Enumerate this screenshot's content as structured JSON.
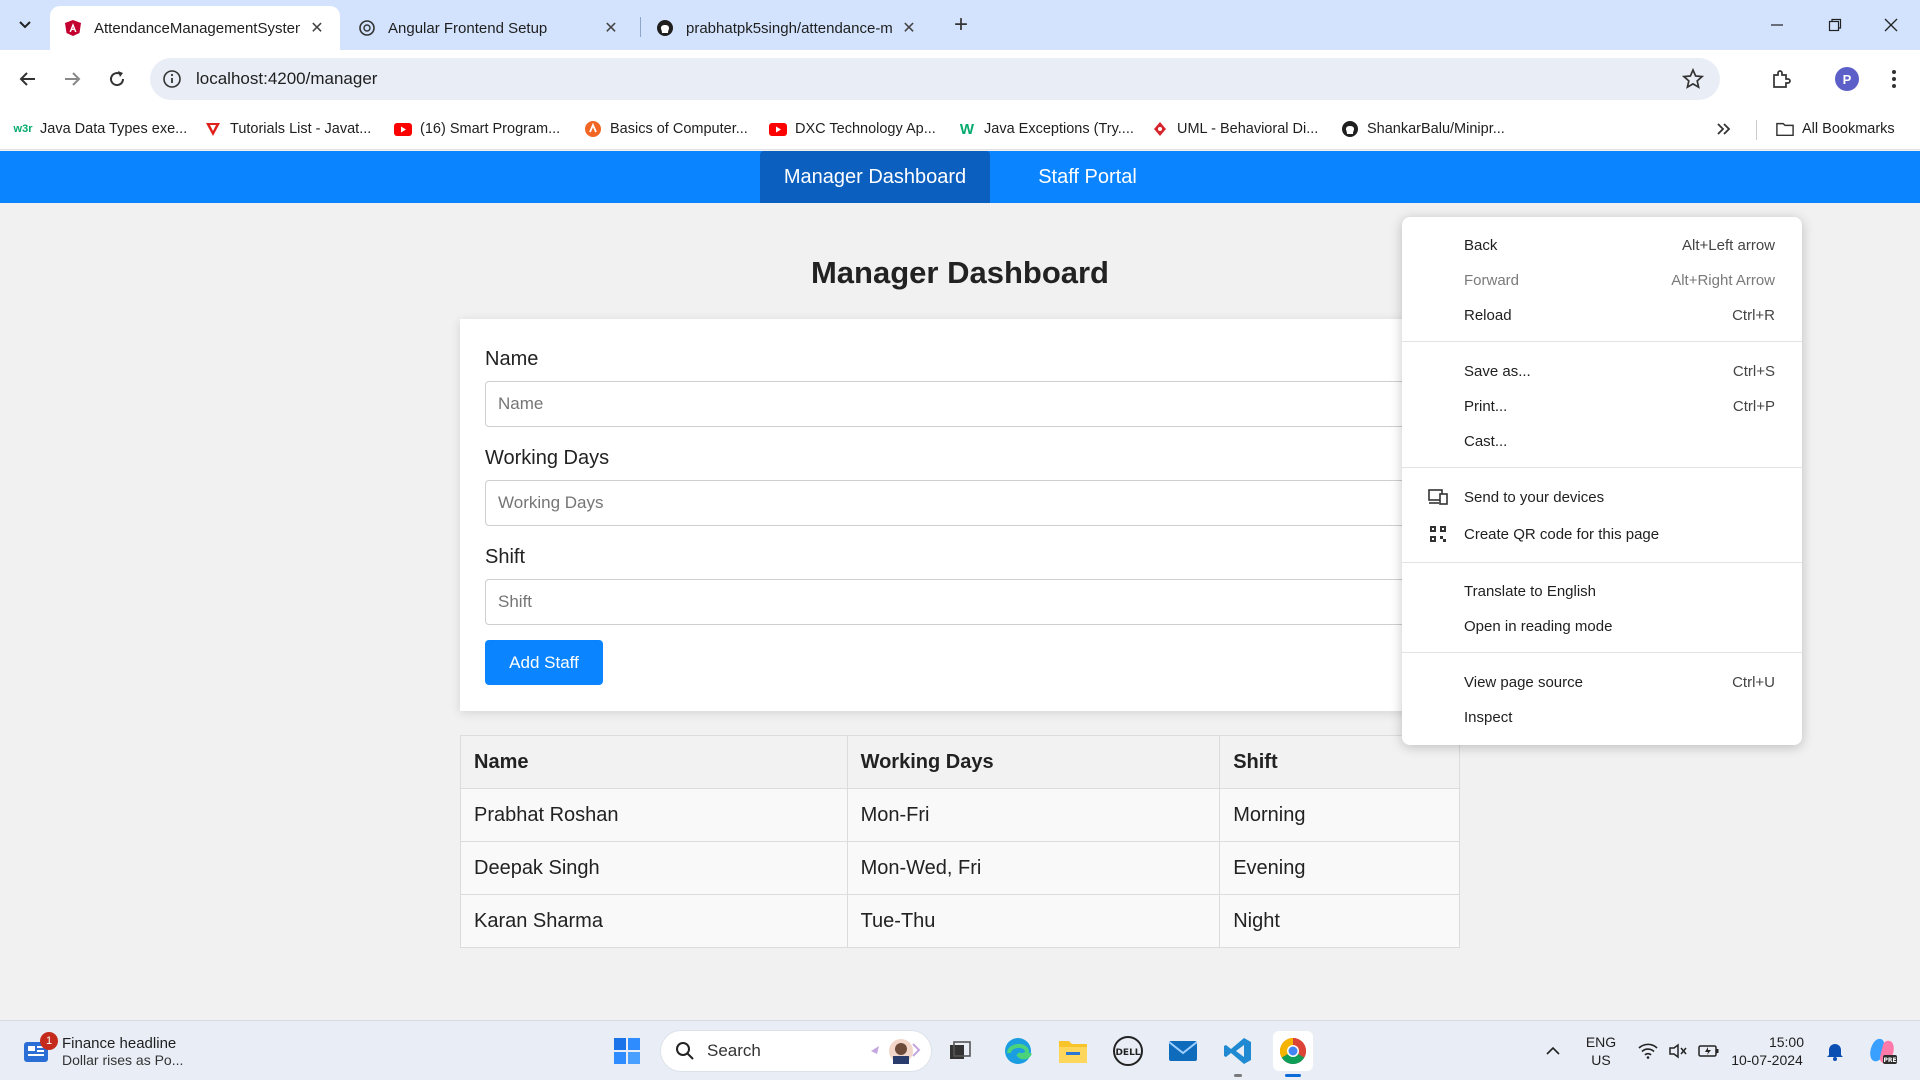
{
  "browser": {
    "tabs": [
      {
        "title": "AttendanceManagementSystem",
        "favicon": "angular-icon",
        "active": true
      },
      {
        "title": "Angular Frontend Setup",
        "favicon": "openai-icon",
        "active": false
      },
      {
        "title": "prabhatpk5singh/attendance-m",
        "favicon": "github-icon",
        "active": false
      }
    ],
    "url": "localhost:4200/manager",
    "profile_initial": "P",
    "bookmarks": [
      {
        "label": "Java Data Types exe...",
        "icon": "w3schools-icon"
      },
      {
        "label": "Tutorials List - Javat...",
        "icon": "javatpoint-icon"
      },
      {
        "label": "(16) Smart Program...",
        "icon": "youtube-icon"
      },
      {
        "label": "Basics of Computer...",
        "icon": "orange-logo-icon"
      },
      {
        "label": "DXC Technology Ap...",
        "icon": "youtube-icon"
      },
      {
        "label": "Java Exceptions (Try....",
        "icon": "w3schools-icon"
      },
      {
        "label": "UML - Behavioral Di...",
        "icon": "diamond-icon"
      },
      {
        "label": "ShankarBalu/Minipr...",
        "icon": "github-icon"
      }
    ],
    "all_bookmarks_label": "All Bookmarks"
  },
  "app": {
    "nav": [
      {
        "label": "Manager Dashboard",
        "active": true
      },
      {
        "label": "Staff Portal",
        "active": false
      }
    ],
    "heading": "Manager Dashboard",
    "form": {
      "name_label": "Name",
      "name_placeholder": "Name",
      "days_label": "Working Days",
      "days_placeholder": "Working Days",
      "shift_label": "Shift",
      "shift_placeholder": "Shift",
      "submit_label": "Add Staff"
    },
    "table": {
      "headers": [
        "Name",
        "Working Days",
        "Shift"
      ],
      "rows": [
        [
          "Prabhat Roshan",
          "Mon-Fri",
          "Morning"
        ],
        [
          "Deepak Singh",
          "Mon-Wed, Fri",
          "Evening"
        ],
        [
          "Karan Sharma",
          "Tue-Thu",
          "Night"
        ]
      ]
    }
  },
  "context_menu": {
    "items": [
      {
        "label": "Back",
        "shortcut": "Alt+Left arrow"
      },
      {
        "label": "Forward",
        "shortcut": "Alt+Right Arrow"
      },
      {
        "label": "Reload",
        "shortcut": "Ctrl+R"
      },
      {
        "label": "Save as...",
        "shortcut": "Ctrl+S"
      },
      {
        "label": "Print...",
        "shortcut": "Ctrl+P"
      },
      {
        "label": "Cast...",
        "shortcut": ""
      },
      {
        "label": "Send to your devices",
        "shortcut": ""
      },
      {
        "label": "Create QR code for this page",
        "shortcut": ""
      },
      {
        "label": "Translate to English",
        "shortcut": ""
      },
      {
        "label": "Open in reading mode",
        "shortcut": ""
      },
      {
        "label": "View page source",
        "shortcut": "Ctrl+U"
      },
      {
        "label": "Inspect",
        "shortcut": ""
      }
    ]
  },
  "taskbar": {
    "news_title": "Finance headline",
    "news_sub": "Dollar rises as Po...",
    "news_badge": "1",
    "search_label": "Search",
    "lang": "ENG",
    "region": "US",
    "time": "15:00",
    "date": "10-07-2024"
  }
}
